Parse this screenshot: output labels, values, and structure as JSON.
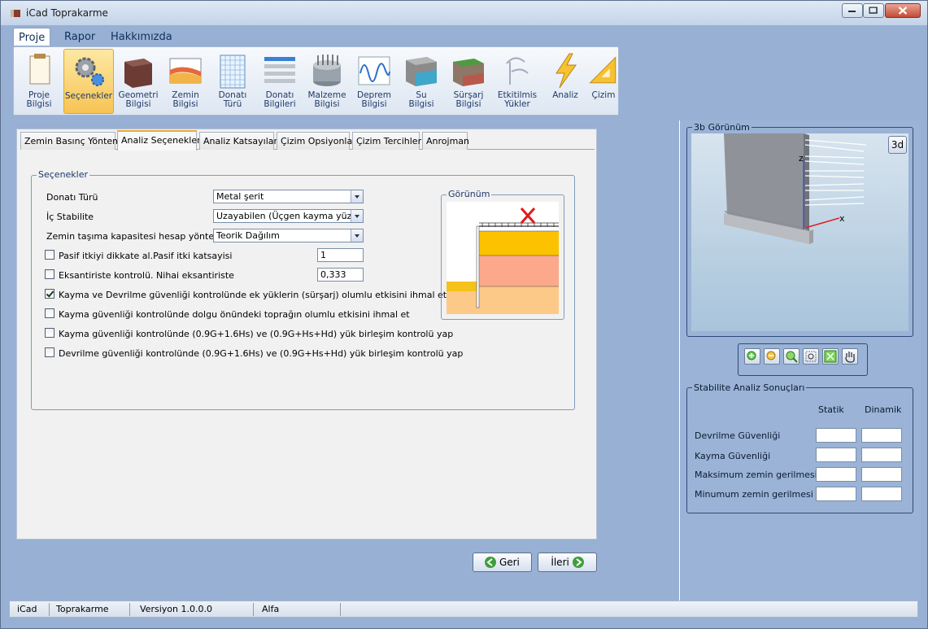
{
  "window": {
    "title": "iCad Toprakarme"
  },
  "menu_tabs": [
    "Proje",
    "Rapor",
    "Hakkımızda"
  ],
  "ribbon": [
    {
      "line1": "Proje",
      "line2": "Bilgisi",
      "icon": "document-icon"
    },
    {
      "line1": "Seçenekler",
      "line2": "",
      "icon": "gears-icon"
    },
    {
      "line1": "Geometri",
      "line2": "Bilgisi",
      "icon": "wall-geometry-icon"
    },
    {
      "line1": "Zemin",
      "line2": "Bilgisi",
      "icon": "soil-layers-icon"
    },
    {
      "line1": "Donatı",
      "line2": "Türü",
      "icon": "grid-icon"
    },
    {
      "line1": "Donatı",
      "line2": "Bilgileri",
      "icon": "reinforcement-list-icon"
    },
    {
      "line1": "Malzeme",
      "line2": "Bilgisi",
      "icon": "material-icon"
    },
    {
      "line1": "Deprem",
      "line2": "Bilgisi",
      "icon": "seismic-wave-icon"
    },
    {
      "line1": "Su",
      "line2": "Bilgisi",
      "icon": "water-icon"
    },
    {
      "line1": "Sürşarj",
      "line2": "Bilgisi",
      "icon": "surcharge-icon"
    },
    {
      "line1": "Etkitilmis",
      "line2": "Yükler",
      "icon": "loads-icon"
    },
    {
      "line1": "Analiz",
      "line2": "",
      "icon": "lightning-icon"
    },
    {
      "line1": "Çizim",
      "line2": "",
      "icon": "triangle-ruler-icon"
    }
  ],
  "panel_tabs": [
    "Zemin Basınç Yöntemi",
    "Analiz Seçenekleri",
    "Analiz Katsayıları",
    "Çizim Opsiyonları",
    "Çizim Tercihleri",
    "Anrojman"
  ],
  "secenekler": {
    "legend": "Seçenekler",
    "donati_turu": {
      "label": "Donatı Türü",
      "value": "Metal şerit"
    },
    "ic_stabilite": {
      "label": "İç Stabilite",
      "value": "Uzayabilen (Üçgen kayma yüzeyi)"
    },
    "zemin_tasima": {
      "label": "Zemin taşıma kapasitesi hesap yöntemi",
      "value": "Teorik Dağılım"
    },
    "pasif": {
      "label": "Pasif itkiyi dikkate al.Pasif itki katsayisi",
      "value": "1",
      "checked": false
    },
    "eksantirite": {
      "label": "Eksantiriste kontrolü. Nihai eksantiriste",
      "value": "0,333",
      "checked": false
    },
    "checks": [
      {
        "label": "Kayma ve Devrilme güvenliği kontrolünde ek yüklerin (sürşarj) olumlu etkisini ihmal et",
        "checked": true
      },
      {
        "label": "Kayma güvenliği kontrolünde  dolgu önündeki toprağın olumlu etkisini  ihmal et",
        "checked": false
      },
      {
        "label": "Kayma güvenliği kontrolünde (0.9G+1.6Hs) ve (0.9G+Hs+Hd) yük birleşim kontrolü yap",
        "checked": false
      },
      {
        "label": "Devrilme güvenliği kontrolünde (0.9G+1.6Hs) ve (0.9G+Hs+Hd) yük birleşim kontrolü yap",
        "checked": false
      }
    ],
    "gorunum_legend": "Görünüm"
  },
  "nav": {
    "back": "Geri",
    "next": "İleri"
  },
  "view3d": {
    "legend": "3b Görünüm",
    "mode_label": "3d",
    "axis_x": "x",
    "axis_z": "z"
  },
  "stabilite": {
    "legend": "Stabilite Analiz Sonuçları",
    "col_static": "Statik",
    "col_dynamic": "Dinamik",
    "rows": [
      "Devrilme Güvenliği",
      "Kayma Güvenliği",
      "Maksimum zemin gerilmesi",
      "Minumum zemin gerilmesi"
    ]
  },
  "statusbar": [
    "iCad",
    "Toprakarme",
    "Versiyon 1.0.0.0",
    "Alfa"
  ],
  "colors": {
    "accent": "#f7c454",
    "window_bg": "#97b0d3"
  }
}
